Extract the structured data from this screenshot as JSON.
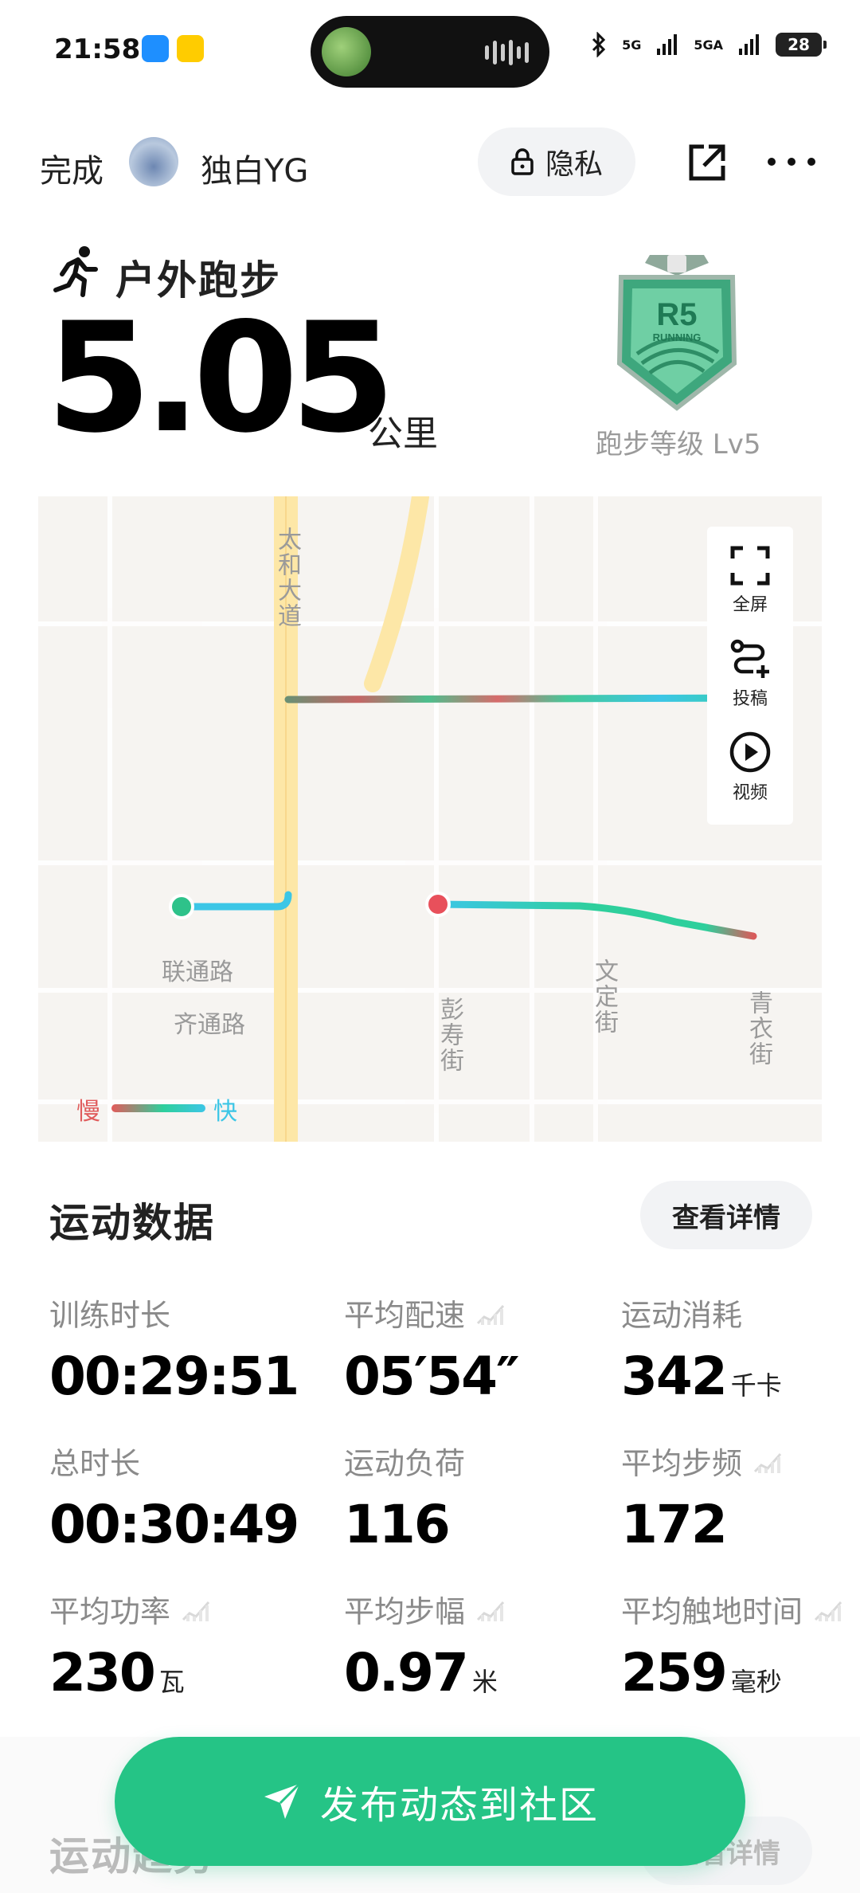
{
  "status_bar": {
    "time": "21:58",
    "network_1": "5G",
    "network_2": "5GA",
    "battery": "28"
  },
  "header": {
    "done_label": "完成",
    "username": "独白YG",
    "privacy_label": "隐私"
  },
  "activity": {
    "type_label": "户外跑步",
    "distance": "5.05",
    "distance_unit": "公里",
    "badge_text": "R5",
    "badge_subtext": "RUNNING",
    "level_label": "跑步等级 Lv5"
  },
  "map": {
    "road_labels": {
      "taihe": "太和大道",
      "liantong": "联通路",
      "qitong": "齐通路",
      "pengshou": "彭寿街",
      "wending": "文定街",
      "qingyi": "青衣街"
    },
    "tools": {
      "fullscreen": "全屏",
      "submit": "投稿",
      "video": "视频"
    },
    "legend": {
      "slow": "慢",
      "fast": "快"
    },
    "colors": {
      "slow": "#e35a5a",
      "mid": "#2ecf9c",
      "fast": "#3cc6e6"
    }
  },
  "stats_section": {
    "title": "运动数据",
    "detail_label": "查看详情",
    "items": [
      {
        "label": "训练时长",
        "value": "00:29:51",
        "unit": ""
      },
      {
        "label": "平均配速",
        "value": "05′54″",
        "unit": ""
      },
      {
        "label": "运动消耗",
        "value": "342",
        "unit": "千卡"
      },
      {
        "label": "总时长",
        "value": "00:30:49",
        "unit": ""
      },
      {
        "label": "运动负荷",
        "value": "116",
        "unit": ""
      },
      {
        "label": "平均步频",
        "value": "172",
        "unit": ""
      },
      {
        "label": "平均功率",
        "value": "230",
        "unit": "瓦"
      },
      {
        "label": "平均步幅",
        "value": "0.97",
        "unit": "米"
      },
      {
        "label": "平均触地时间",
        "value": "259",
        "unit": "毫秒"
      }
    ]
  },
  "bottom": {
    "trend_title": "运动趋势",
    "detail_label": "查看详情",
    "publish_label": "发布动态到社区"
  },
  "colors": {
    "accent_green": "#25c486"
  }
}
